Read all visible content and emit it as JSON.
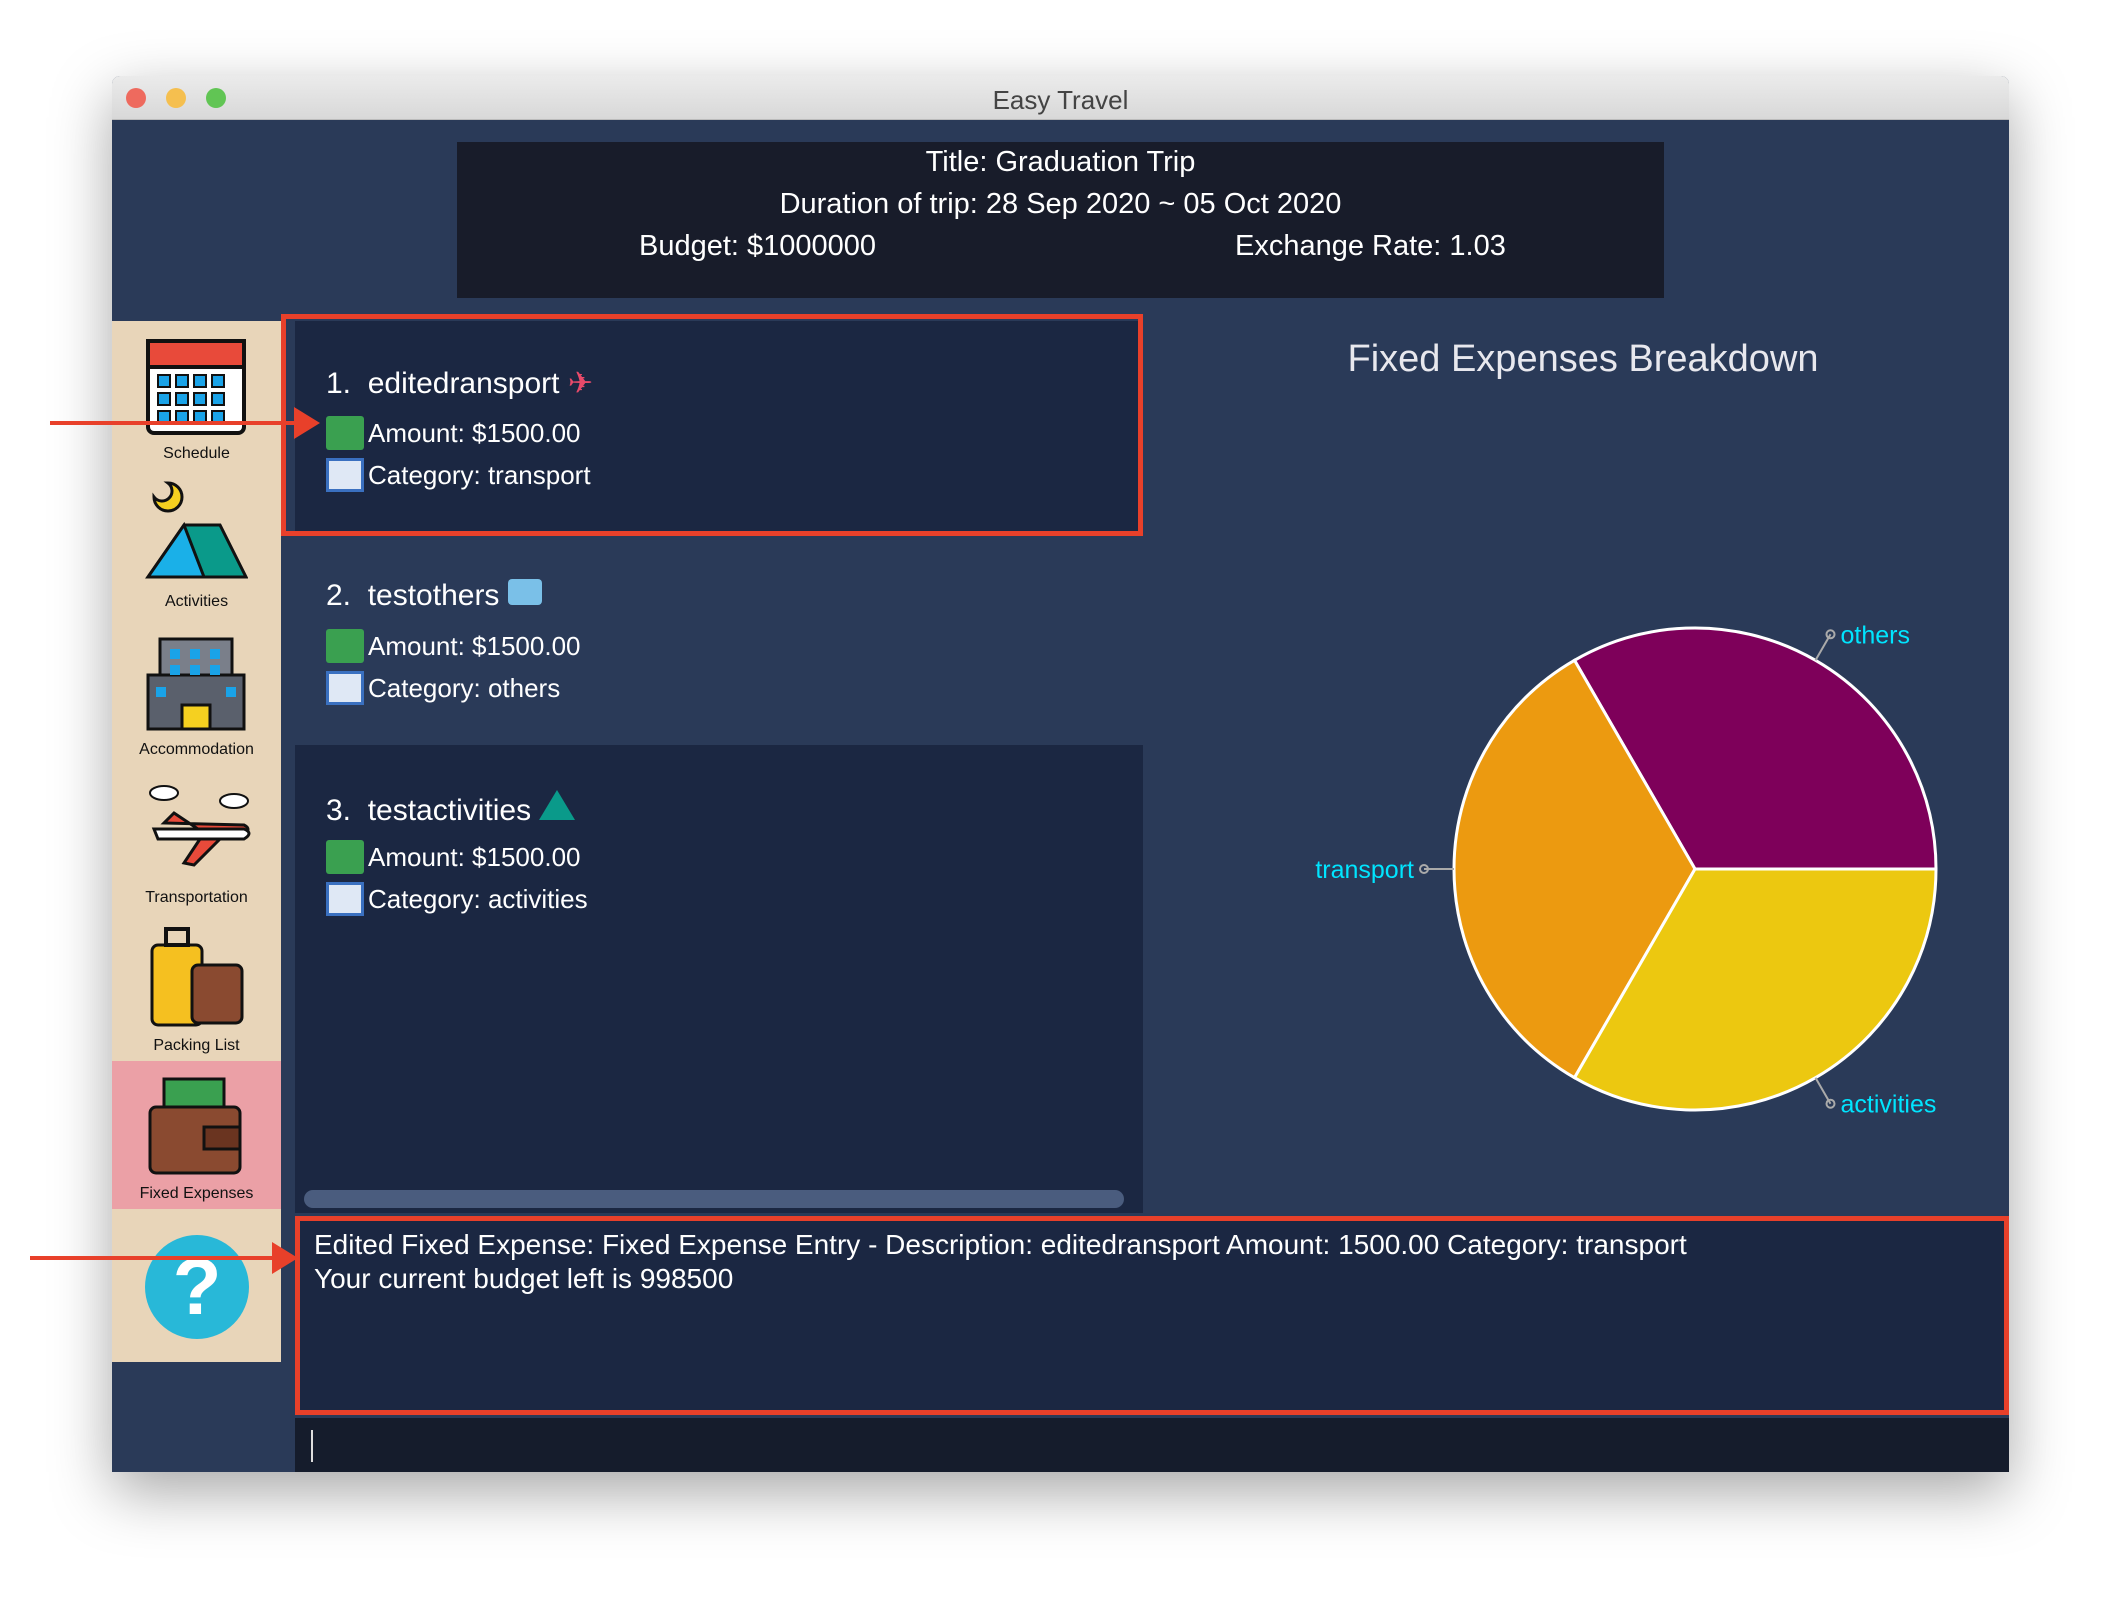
{
  "window": {
    "title": "Easy Travel"
  },
  "header": {
    "title": "Title: Graduation Trip",
    "duration": "Duration of trip: 28 Sep 2020 ~ 05 Oct 2020",
    "budget": "Budget: $1000000",
    "exchange_rate": "Exchange Rate: 1.03"
  },
  "sidebar": {
    "items": [
      {
        "label": "Schedule",
        "icon": "calendar-icon"
      },
      {
        "label": "Activities",
        "icon": "tent-icon"
      },
      {
        "label": "Accommodation",
        "icon": "hotel-icon"
      },
      {
        "label": "Transportation",
        "icon": "airplane-icon"
      },
      {
        "label": "Packing List",
        "icon": "luggage-icon"
      },
      {
        "label": "Fixed Expenses",
        "icon": "wallet-icon",
        "active": true
      },
      {
        "label": "?",
        "icon": "help-icon"
      }
    ]
  },
  "expenses": [
    {
      "index": "1.",
      "description": "editedransport",
      "amount": "Amount: $1500.00",
      "category": "Category: transport",
      "icon": "airplane-icon"
    },
    {
      "index": "2.",
      "description": "testothers",
      "amount": "Amount: $1500.00",
      "category": "Category: others",
      "icon": "tickets-icon"
    },
    {
      "index": "3.",
      "description": "testactivities",
      "amount": "Amount: $1500.00",
      "category": "Category: activities",
      "icon": "tent-icon"
    }
  ],
  "result": {
    "line1": "Edited Fixed Expense: Fixed Expense Entry - Description: editedransport Amount: 1500.00 Category: transport",
    "line2": "Your current budget left is 998500"
  },
  "command": {
    "value": ""
  },
  "colors": {
    "background": "#2a3a58",
    "panel": "#1b2742",
    "highlight": "#e8402a",
    "label": "#00e5ff"
  },
  "chart_data": {
    "type": "pie",
    "title": "Fixed Expenses Breakdown",
    "categories": [
      "others",
      "transport",
      "activities"
    ],
    "values": [
      1500,
      1500,
      1500
    ],
    "colors": [
      "#7e005a",
      "#ec9a10",
      "#ecc810"
    ],
    "label_color": "#00e5ff"
  }
}
